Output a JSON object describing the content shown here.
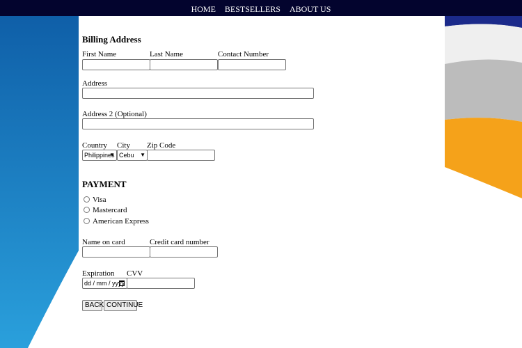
{
  "nav": {
    "items": [
      "HOME",
      "BESTSELLERS",
      "ABOUT US"
    ]
  },
  "billing": {
    "heading": "Billing Address",
    "first_name_label": "First Name",
    "last_name_label": "Last Name",
    "contact_label": "Contact Number",
    "address_label": "Address",
    "address2_label": "Address 2 (Optional)",
    "country_label": "Country",
    "city_label": "City",
    "zip_label": "Zip Code",
    "country_value": "Philippines",
    "city_value": "Cebu"
  },
  "payment": {
    "heading": "PAYMENT",
    "options": [
      "Visa",
      "Mastercard",
      "American Express"
    ],
    "name_label": "Name on card",
    "card_number_label": "Credit card number",
    "expiration_label": "Expiration",
    "cvv_label": "CVV",
    "expiration_placeholder": "dd / mm / yyyy"
  },
  "actions": {
    "back": "BACK",
    "continue": "CONTINUE"
  },
  "colors": {
    "topbar": "#03042e",
    "blue": "#1a6fb3",
    "orange": "#f5a21a",
    "gray": "#bdbdbd"
  }
}
